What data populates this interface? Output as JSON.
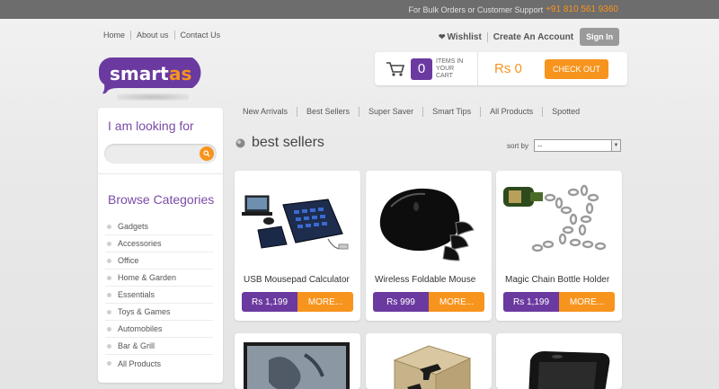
{
  "topbar": {
    "support_text": "For Bulk Orders or Customer Support",
    "phone": "+91 810 561 9360"
  },
  "header": {
    "links": [
      "Home",
      "About us",
      "Contact Us"
    ],
    "wishlist": "Wishlist",
    "create_account": "Create An Account",
    "sign_in": "Sign In",
    "logo_text": "smartas"
  },
  "cart": {
    "count": "0",
    "label": "ITEMS IN YOUR CART",
    "total": "Rs 0",
    "checkout": "CHECK OUT"
  },
  "sidebar": {
    "search_heading": "I am looking for",
    "search_placeholder": "",
    "categories_heading": "Browse Categories",
    "categories": [
      "Gadgets",
      "Accessories",
      "Office",
      "Home & Garden",
      "Essentials",
      "Toys & Games",
      "Automobiles",
      "Bar & Grill",
      "All Products"
    ]
  },
  "nav": [
    "New Arrivals",
    "Best Sellers",
    "Super Saver",
    "Smart Tips",
    "All Products",
    "Spotted"
  ],
  "section": {
    "title": "best sellers",
    "sort_label": "sort by",
    "sort_value": "--"
  },
  "products": [
    {
      "name": "USB Mousepad Calculator",
      "price": "Rs 1,199",
      "more": "MORE..."
    },
    {
      "name": "Wireless Foldable Mouse",
      "price": "Rs 999",
      "more": "MORE..."
    },
    {
      "name": "Magic Chain Bottle Holder",
      "price": "Rs 1,199",
      "more": "MORE..."
    },
    {
      "name": "",
      "price": "",
      "more": ""
    },
    {
      "name": "",
      "price": "",
      "more": ""
    },
    {
      "name": "",
      "price": "",
      "more": ""
    }
  ],
  "colors": {
    "purple": "#6b3aa0",
    "orange": "#f7941d"
  }
}
